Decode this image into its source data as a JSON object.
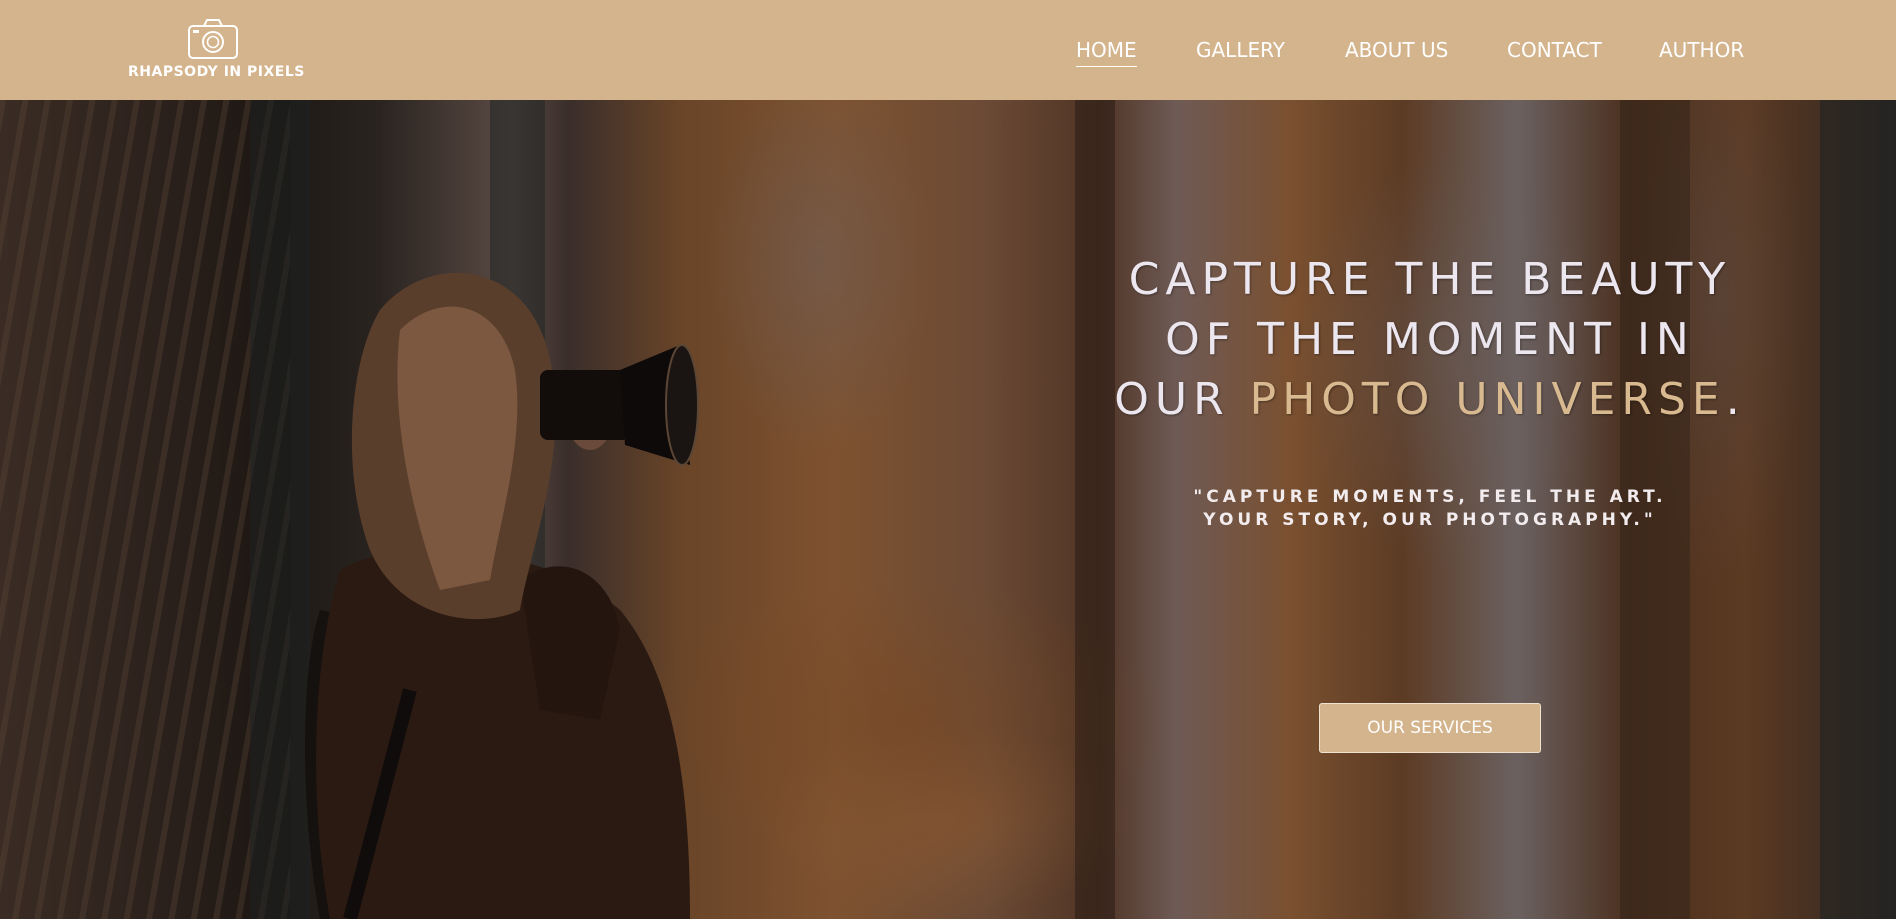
{
  "brand": {
    "name": "RHAPSODY IN PIXELS",
    "icon": "camera-icon",
    "primary_color": "#d4b48c",
    "accent_color": "#d9b98f"
  },
  "nav": {
    "items": [
      {
        "label": "HOME",
        "active": true
      },
      {
        "label": "GALLERY",
        "active": false
      },
      {
        "label": "ABOUT US",
        "active": false
      },
      {
        "label": "CONTACT",
        "active": false
      },
      {
        "label": "AUTHOR",
        "active": false
      }
    ]
  },
  "hero": {
    "headline_line1": "CAPTURE THE BEAUTY",
    "headline_line2": "OF THE MOMENT IN",
    "headline_line3_start": "OUR ",
    "headline_accent": "PHOTO UNIVERSE",
    "headline_end": ".",
    "tagline_line1": "\"CAPTURE MOMENTS, FEEL THE ART.",
    "tagline_line2": "YOUR STORY, OUR PHOTOGRAPHY.\"",
    "cta_label": "OUR SERVICES"
  }
}
